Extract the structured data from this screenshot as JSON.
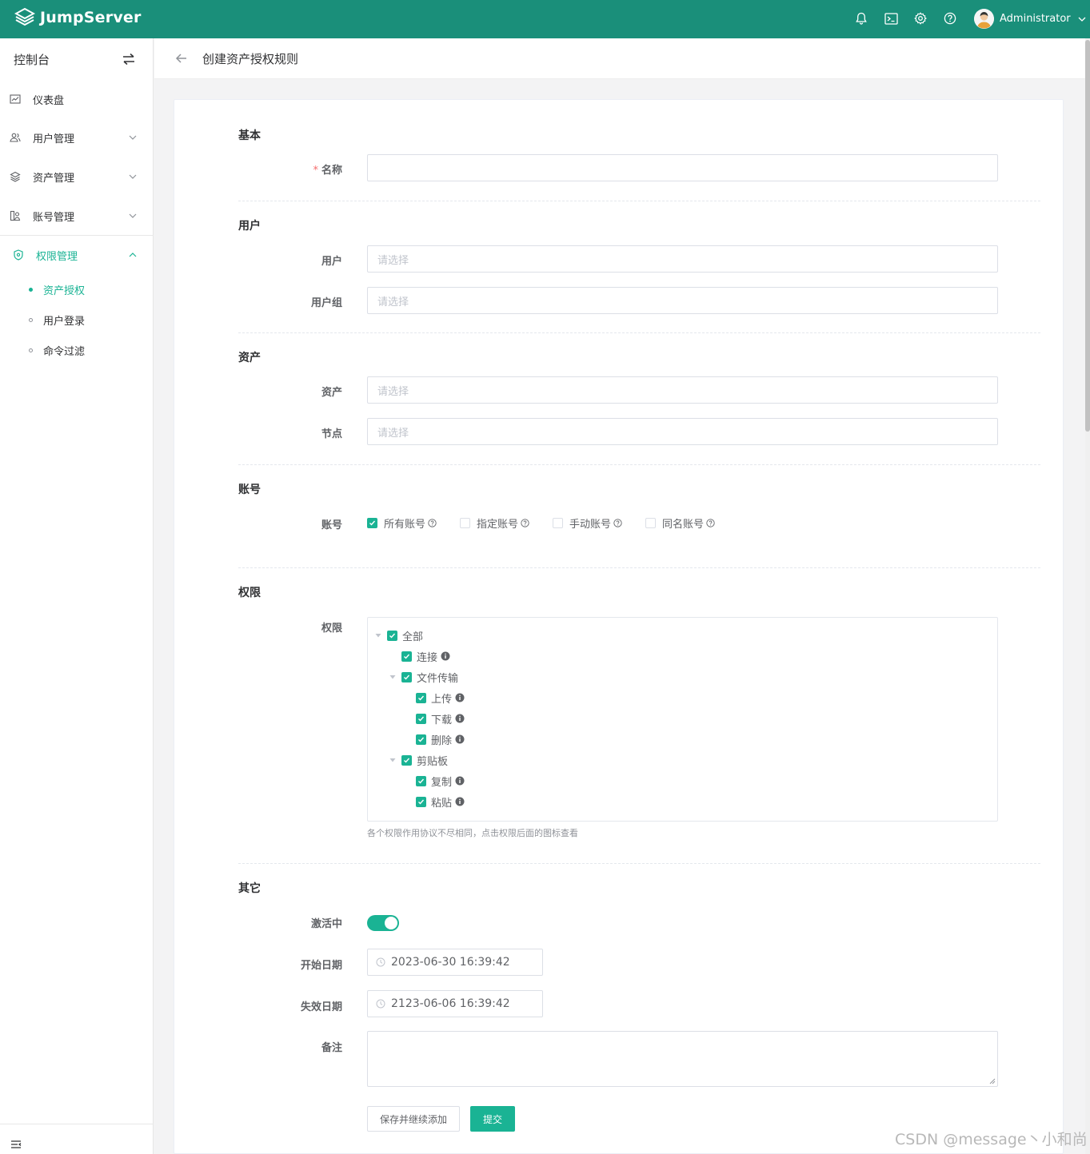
{
  "topbar": {
    "logo_text": "JumpServer",
    "icons": [
      "bell-icon",
      "terminal-icon",
      "gear-icon",
      "help-icon"
    ],
    "user_name": "Administrator",
    "color": "#1a8f7a"
  },
  "sidebar": {
    "title": "控制台",
    "items": [
      {
        "label": "仪表盘",
        "icon": "dashboard-icon"
      },
      {
        "label": "用户管理",
        "icon": "users-icon"
      },
      {
        "label": "资产管理",
        "icon": "layers-icon"
      },
      {
        "label": "账号管理",
        "icon": "account-icon"
      },
      {
        "label": "权限管理",
        "icon": "shield-icon",
        "active": true
      }
    ],
    "sub_items": [
      {
        "label": "资产授权",
        "active": true
      },
      {
        "label": "用户登录"
      },
      {
        "label": "命令过滤"
      }
    ]
  },
  "header": {
    "title": "创建资产授权规则"
  },
  "form": {
    "sections": {
      "basic": "基本",
      "user": "用户",
      "asset": "资产",
      "account": "账号",
      "permission": "权限",
      "other": "其它"
    },
    "labels": {
      "name": "名称",
      "user": "用户",
      "user_group": "用户组",
      "asset": "资产",
      "node": "节点",
      "account": "账号",
      "permission": "权限",
      "active": "激活中",
      "start_date": "开始日期",
      "expire_date": "失效日期",
      "comment": "备注"
    },
    "name_value": "",
    "placeholder": "请选择",
    "account_options": [
      {
        "label": "所有账号",
        "checked": true
      },
      {
        "label": "指定账号",
        "checked": false
      },
      {
        "label": "手动账号",
        "checked": false
      },
      {
        "label": "同名账号",
        "checked": false
      }
    ],
    "permission_tree": {
      "all": "全部",
      "connect": "连接",
      "file_transfer": "文件传输",
      "upload": "上传",
      "download": "下载",
      "delete": "删除",
      "clipboard": "剪贴板",
      "copy": "复制",
      "paste": "粘贴"
    },
    "permission_hint": "各个权限作用协议不尽相同，点击权限后面的图标查看",
    "is_active": true,
    "start_date": "2023-06-30 16:39:42",
    "expire_date": "2123-06-06 16:39:42",
    "comment_value": "",
    "buttons": {
      "save_continue": "保存并继续添加",
      "submit": "提交"
    }
  },
  "watermark": "CSDN @message丶小和尚",
  "accent_color": "#1ab394"
}
